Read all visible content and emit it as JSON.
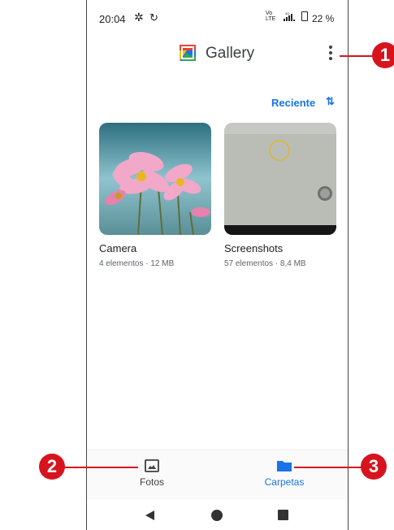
{
  "status_bar": {
    "time": "20:04",
    "gear_icon": "gear-icon",
    "sync_icon": "sync-icon",
    "net_top": "Vo",
    "net_bottom": "LTE",
    "net_4g": "4G",
    "battery": "22 %"
  },
  "app_bar": {
    "title": "Gallery",
    "menu_icon": "more-vert-icon"
  },
  "sort": {
    "label": "Reciente",
    "icon": "sort-arrows-icon"
  },
  "albums": [
    {
      "name": "Camera",
      "meta": "4 elementos · 12 MB"
    },
    {
      "name": "Screenshots",
      "meta": "57 elementos · 8,4 MB"
    }
  ],
  "bottom_nav": {
    "items": [
      {
        "label": "Fotos",
        "icon": "photo-icon",
        "active": false
      },
      {
        "label": "Carpetas",
        "icon": "folder-icon",
        "active": true
      }
    ]
  },
  "callouts": [
    "1",
    "2",
    "3"
  ],
  "colors": {
    "accent": "#1a73e8",
    "callout": "#d7141e",
    "text": "#202124"
  }
}
